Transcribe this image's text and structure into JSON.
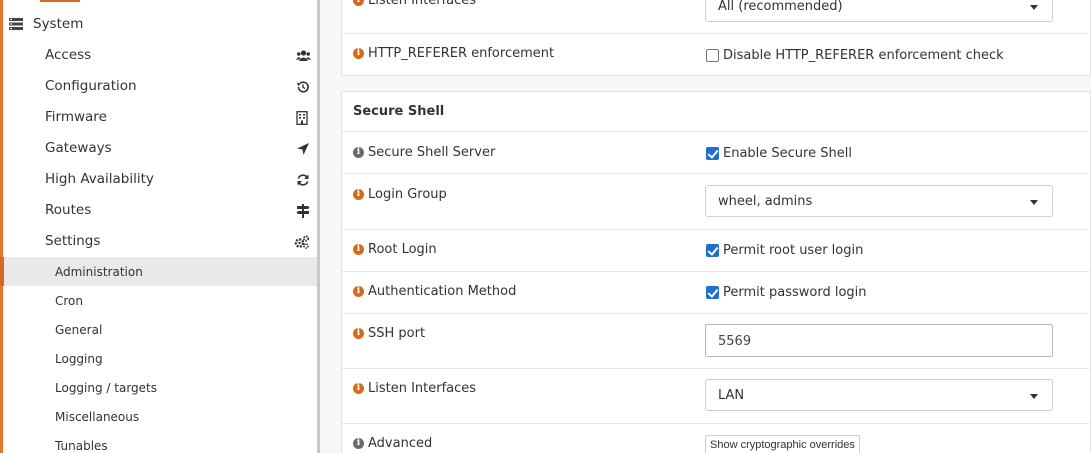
{
  "sidebar": {
    "section": "System",
    "items": [
      {
        "label": "Access",
        "icon": "users-icon"
      },
      {
        "label": "Configuration",
        "icon": "history-icon"
      },
      {
        "label": "Firmware",
        "icon": "building-icon"
      },
      {
        "label": "Gateways",
        "icon": "location-arrow-icon"
      },
      {
        "label": "High Availability",
        "icon": "refresh-icon"
      },
      {
        "label": "Routes",
        "icon": "map-signs-icon"
      },
      {
        "label": "Settings",
        "icon": "cogs-icon"
      }
    ],
    "subitems": [
      "Administration",
      "Cron",
      "General",
      "Logging",
      "Logging / targets",
      "Miscellaneous",
      "Tunables"
    ]
  },
  "top_panel": {
    "listen_interfaces_label": "Listen Interfaces",
    "listen_interfaces_value": "All (recommended)",
    "http_referer_label": "HTTP_REFERER enforcement",
    "http_referer_check_label": "Disable HTTP_REFERER enforcement check"
  },
  "ssh": {
    "title": "Secure Shell",
    "server_label": "Secure Shell Server",
    "server_check": "Enable Secure Shell",
    "login_group_label": "Login Group",
    "login_group_value": "wheel, admins",
    "root_login_label": "Root Login",
    "root_login_check": "Permit root user login",
    "auth_label": "Authentication Method",
    "auth_check": "Permit password login",
    "port_label": "SSH port",
    "port_value": "5569",
    "listen_label": "Listen Interfaces",
    "listen_value": "LAN",
    "advanced_label": "Advanced",
    "advanced_button": "Show cryptographic overrides"
  },
  "colors": {
    "accent": "#d46a1a",
    "checkbox": "#1f6fd1"
  }
}
